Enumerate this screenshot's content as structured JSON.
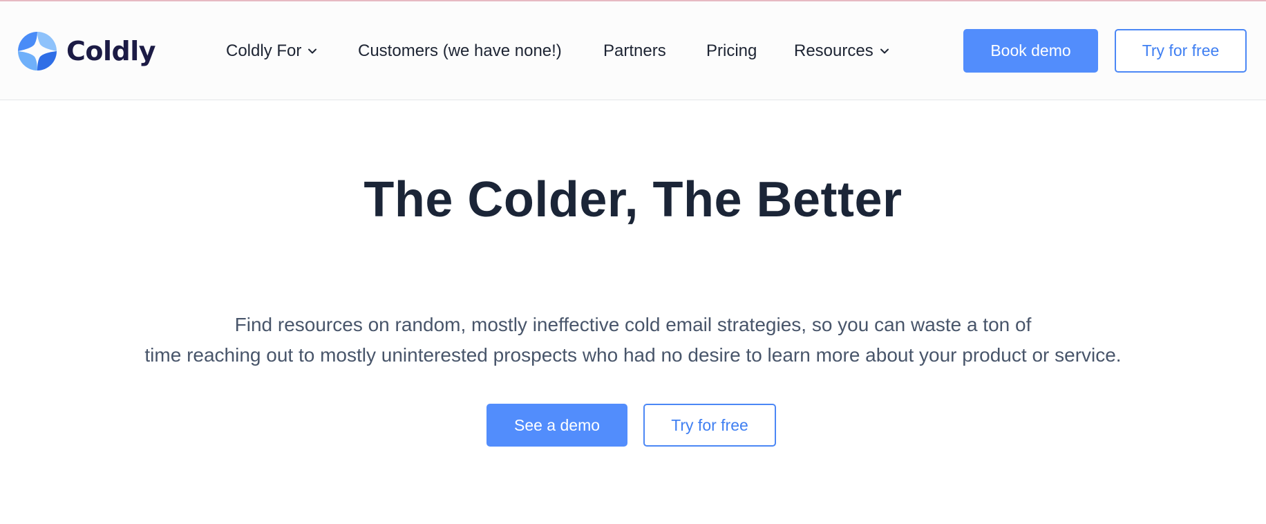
{
  "brand": {
    "name": "Coldly",
    "logo_icon": "coldly-logo-icon",
    "logo_colors": [
      "#4a8cf7",
      "#8ec2fb",
      "#2f6ee6",
      "#6fb0fa"
    ]
  },
  "nav": {
    "items": [
      {
        "label": "Coldly For",
        "has_dropdown": true
      },
      {
        "label": "Customers (we have none!)",
        "has_dropdown": false
      },
      {
        "label": "Partners",
        "has_dropdown": false
      },
      {
        "label": "Pricing",
        "has_dropdown": false
      },
      {
        "label": "Resources",
        "has_dropdown": true
      }
    ],
    "dropdown_icon": "chevron-down-icon",
    "book_demo_label": "Book demo",
    "try_free_label": "Try for free"
  },
  "hero": {
    "title": "The Colder, The Better",
    "subtitle_line1": "Find resources on random, mostly ineffective cold email strategies, so you can waste a ton of",
    "subtitle_line2": "time reaching out to mostly uninterested prospects who had no desire to learn more about your product or service.",
    "see_demo_label": "See a demo",
    "try_free_label": "Try for free"
  },
  "colors": {
    "accent": "#528dfc",
    "text_dark": "#1b2537",
    "text_muted": "#48556a",
    "header_bg": "#fcfcfc"
  }
}
